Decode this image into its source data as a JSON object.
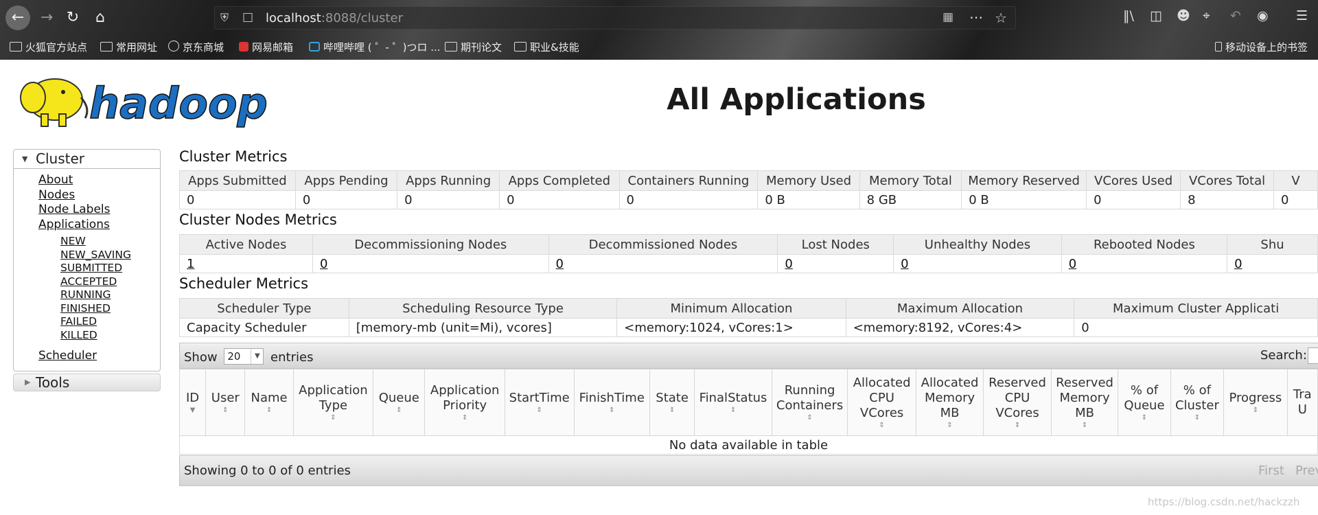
{
  "browser": {
    "url_host": "localhost",
    "url_rest": ":8088/cluster",
    "bookmarks": [
      "火狐官方站点",
      "常用网址",
      "京东商城",
      "网易邮箱",
      "哔哩哔哩 ( ゜- ゜)つロ ...",
      "期刊论文",
      "职业&技能"
    ],
    "mobile_bookmarks": "移动设备上的书签"
  },
  "page": {
    "title": "All Applications",
    "logo_text": "hadoop"
  },
  "nav": {
    "cluster_label": "Cluster",
    "items": [
      "About",
      "Nodes",
      "Node Labels",
      "Applications"
    ],
    "app_states": [
      "NEW",
      "NEW_SAVING",
      "SUBMITTED",
      "ACCEPTED",
      "RUNNING",
      "FINISHED",
      "FAILED",
      "KILLED"
    ],
    "scheduler": "Scheduler",
    "tools_label": "Tools"
  },
  "cluster_metrics": {
    "title": "Cluster Metrics",
    "headers": [
      "Apps Submitted",
      "Apps Pending",
      "Apps Running",
      "Apps Completed",
      "Containers Running",
      "Memory Used",
      "Memory Total",
      "Memory Reserved",
      "VCores Used",
      "VCores Total",
      "V"
    ],
    "values": [
      "0",
      "0",
      "0",
      "0",
      "0",
      "0 B",
      "8 GB",
      "0 B",
      "0",
      "8",
      "0"
    ]
  },
  "nodes_metrics": {
    "title": "Cluster Nodes Metrics",
    "headers": [
      "Active Nodes",
      "Decommissioning Nodes",
      "Decommissioned Nodes",
      "Lost Nodes",
      "Unhealthy Nodes",
      "Rebooted Nodes",
      "Shu"
    ],
    "values": [
      "1",
      "0",
      "0",
      "0",
      "0",
      "0",
      "0"
    ]
  },
  "scheduler_metrics": {
    "title": "Scheduler Metrics",
    "headers": [
      "Scheduler Type",
      "Scheduling Resource Type",
      "Minimum Allocation",
      "Maximum Allocation",
      "Maximum Cluster Applicati"
    ],
    "values": [
      "Capacity Scheduler",
      "[memory-mb (unit=Mi), vcores]",
      "<memory:1024, vCores:1>",
      "<memory:8192, vCores:4>",
      "0"
    ]
  },
  "apps_table": {
    "show_label": "Show",
    "entries_value": "20",
    "entries_label": "entries",
    "search_label": "Search:",
    "columns": [
      "ID",
      "User",
      "Name",
      "Application Type",
      "Queue",
      "Application Priority",
      "StartTime",
      "FinishTime",
      "State",
      "FinalStatus",
      "Running Containers",
      "Allocated CPU VCores",
      "Allocated Memory MB",
      "Reserved CPU VCores",
      "Reserved Memory MB",
      "% of Queue",
      "% of Cluster",
      "Progress",
      "Tra U"
    ],
    "empty_message": "No data available in table",
    "info": "Showing 0 to 0 of 0 entries",
    "first_label": "First",
    "prev_label": "Prev"
  },
  "watermark": "https://blog.csdn.net/hackzzh"
}
